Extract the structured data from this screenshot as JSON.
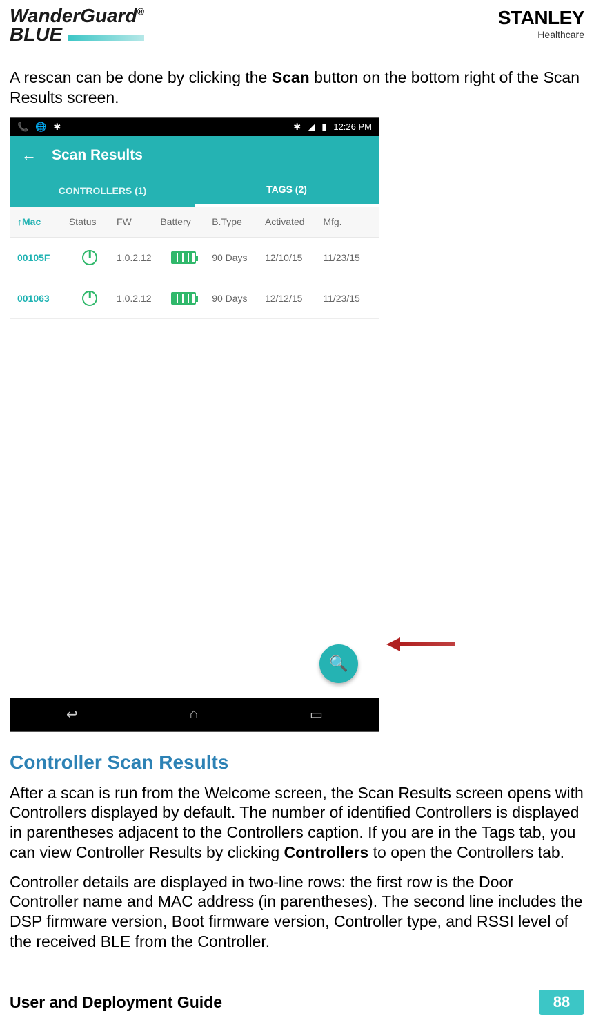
{
  "header": {
    "brand_main": "WanderGuard",
    "brand_reg": "®",
    "brand_sub": "BLUE",
    "right_brand": "STANLEY",
    "right_sub": "Healthcare"
  },
  "intro_text_pre": "A rescan can be done by clicking the ",
  "intro_text_bold": "Scan",
  "intro_text_post": " button on the bottom right of the Scan Results screen.",
  "phone": {
    "statusbar": {
      "time": "12:26 PM"
    },
    "appbar": {
      "title": "Scan Results"
    },
    "tabs": {
      "controllers": "CONTROLLERS (1)",
      "tags": "TAGS (2)"
    },
    "columns": {
      "mac_sort": "↑",
      "mac": "Mac",
      "status": "Status",
      "fw": "FW",
      "battery": "Battery",
      "btype": "B.Type",
      "activated": "Activated",
      "mfg": "Mfg."
    },
    "rows": [
      {
        "mac": "00105F",
        "fw": "1.0.2.12",
        "btype": "90 Days",
        "activated": "12/10/15",
        "mfg": "11/23/15"
      },
      {
        "mac": "001063",
        "fw": "1.0.2.12",
        "btype": "90 Days",
        "activated": "12/12/15",
        "mfg": "11/23/15"
      }
    ]
  },
  "section_title": "Controller Scan Results",
  "para1_pre": "After a scan is run from the Welcome screen, the Scan Results screen opens with Controllers displayed by default. The number of identified Controllers is displayed in parentheses adjacent to the Controllers caption. If you are in the Tags tab, you can view Controller Results by clicking ",
  "para1_bold": "Controllers",
  "para1_post": " to open the Controllers tab.",
  "para2": "Controller details are displayed in two-line rows: the first row is the Door Controller name and MAC address (in parentheses). The second line includes the DSP firmware version, Boot firmware version, Controller type, and RSSI level of the received BLE from the Controller.",
  "footer": {
    "text": "User and Deployment Guide",
    "page": "88"
  }
}
